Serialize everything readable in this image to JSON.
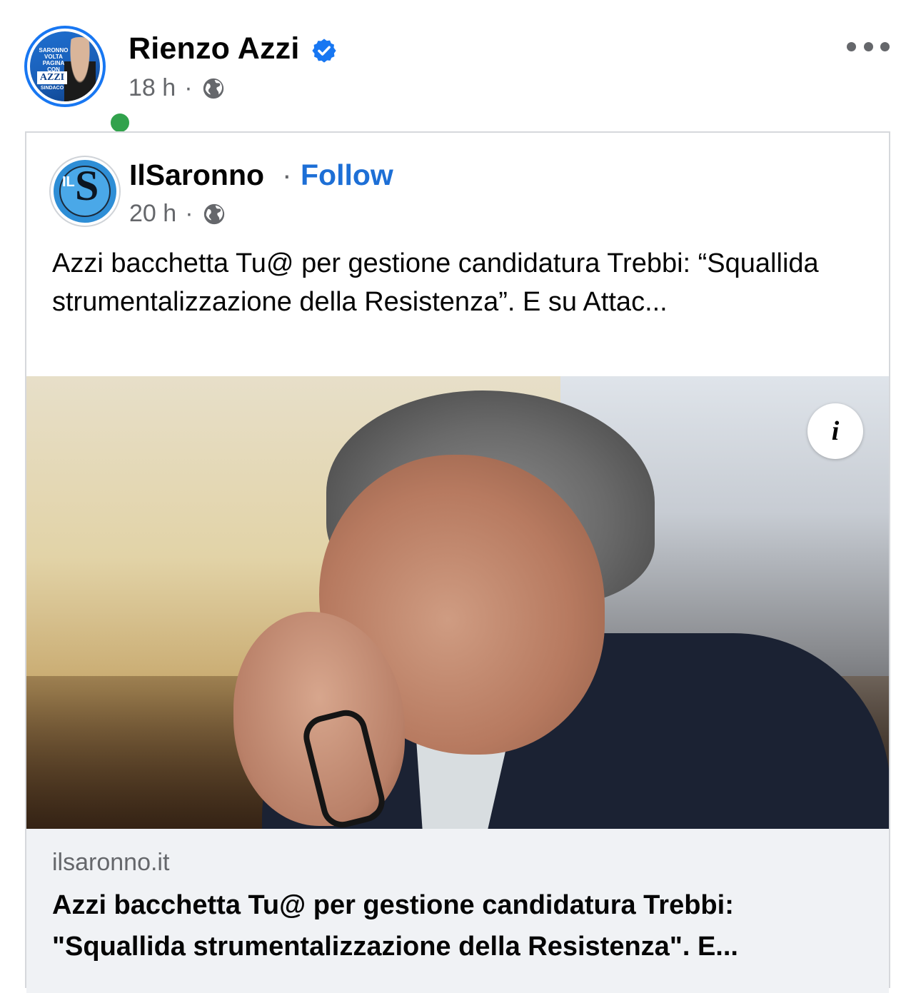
{
  "post": {
    "author_name": "Rienzo Azzi",
    "time": "18 h",
    "separator": "·",
    "avatar_lines": [
      "SARONNO",
      "VOLTA",
      "PAGINA",
      "CON"
    ],
    "avatar_logo": "AZZI",
    "avatar_role": "SINDACO"
  },
  "shared": {
    "source_name": "IlSaronno",
    "separator": "·",
    "follow_label": "Follow",
    "time": "20 h",
    "avatar_letters_small": "IL",
    "avatar_letter_big": "S",
    "text": "Azzi bacchetta Tu@ per gestione candidatura Trebbi: “Squallida strumentalizzazione della Resistenza”. E su Attac...",
    "info_label": "i",
    "link": {
      "domain": "ilsaronno.it",
      "title": "Azzi bacchetta Tu@ per gestione candidatura Trebbi: \"Squallida strumentalizzazione della Resistenza\". E..."
    }
  },
  "icons": {
    "verified": "verified-badge-icon",
    "globe": "globe-icon",
    "more": "more-options-icon",
    "info": "info-icon"
  },
  "colors": {
    "accent": "#1877f2",
    "link": "#1d6fd6",
    "online": "#31a24c",
    "muted": "#65676b"
  }
}
